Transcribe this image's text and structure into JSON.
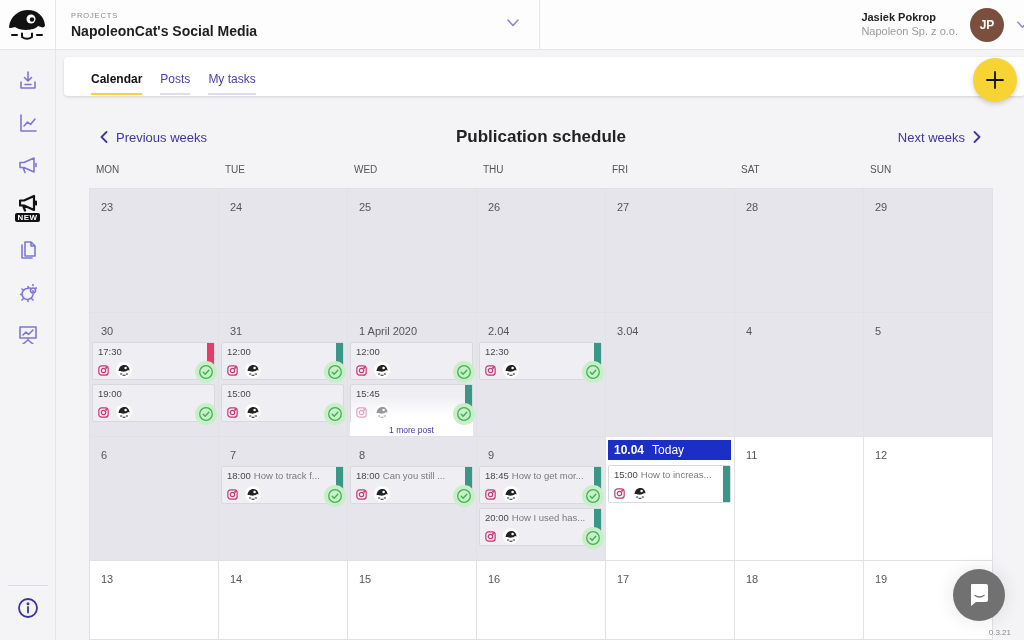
{
  "top_bar": {
    "project_label": "PROJECTS",
    "project_name": "NapoleonCat's Social Media",
    "user_name": "Jasiek Pokrop",
    "user_company": "Napoleon Sp. z o.o.",
    "user_initials": "JP"
  },
  "sidebar": {
    "items": [
      {
        "selected": false
      },
      {
        "selected": false
      },
      {
        "selected": false
      },
      {
        "selected": true,
        "badge": "NEW"
      },
      {
        "selected": false
      },
      {
        "selected": false
      },
      {
        "selected": false
      }
    ]
  },
  "tabs": [
    {
      "label": "Calendar",
      "selected": true
    },
    {
      "label": "Posts",
      "selected": false
    },
    {
      "label": "My tasks",
      "selected": false
    }
  ],
  "calendar": {
    "previous": "Previous weeks",
    "title": "Publication schedule",
    "next": "Next weeks",
    "weekdays": [
      "MON",
      "TUE",
      "WED",
      "THU",
      "FRI",
      "SAT",
      "SUN"
    ],
    "weeks": [
      {
        "days": [
          {
            "date": "23",
            "past": true,
            "today": false
          },
          {
            "date": "24",
            "past": true,
            "today": false
          },
          {
            "date": "25",
            "past": true,
            "today": false
          },
          {
            "date": "26",
            "past": true,
            "today": false
          },
          {
            "date": "27",
            "past": true,
            "today": false
          },
          {
            "date": "28",
            "past": true,
            "today": false
          },
          {
            "date": "29",
            "past": true,
            "today": false
          }
        ]
      },
      {
        "days": [
          {
            "date": "30",
            "past": true,
            "today": false,
            "posts": [
              {
                "time": "17:30",
                "color": "#e23d6b",
                "approved": true
              },
              {
                "time": "19:00",
                "approved": true
              }
            ]
          },
          {
            "date": "31",
            "past": true,
            "today": false,
            "posts": [
              {
                "time": "12:00",
                "color": "#3a9686",
                "approved": true
              },
              {
                "time": "15:00",
                "approved": true
              }
            ]
          },
          {
            "date": "1 April 2020",
            "past": true,
            "today": false,
            "posts": [
              {
                "time": "12:00",
                "approved": true
              },
              {
                "time": "15:45",
                "color": "#3a9686",
                "approved": true
              }
            ],
            "more": "1 more post"
          },
          {
            "date": "2.04",
            "past": true,
            "today": false,
            "posts": [
              {
                "time": "12:30",
                "color": "#3a9686",
                "approved": true
              }
            ]
          },
          {
            "date": "3.04",
            "past": true,
            "today": false
          },
          {
            "date": "4",
            "past": true,
            "today": false
          },
          {
            "date": "5",
            "past": true,
            "today": false
          }
        ]
      },
      {
        "days": [
          {
            "date": "6",
            "past": true,
            "today": false
          },
          {
            "date": "7",
            "past": true,
            "today": false,
            "posts": [
              {
                "time": "18:00",
                "title": "How to track f...",
                "color": "#3a9686",
                "approved": true
              }
            ]
          },
          {
            "date": "8",
            "past": true,
            "today": false,
            "posts": [
              {
                "time": "18:00",
                "title": "Can you still ...",
                "color": "#3a9686",
                "approved": true
              }
            ]
          },
          {
            "date": "9",
            "past": true,
            "today": false,
            "posts": [
              {
                "time": "18:45",
                "title": "How to get mor...",
                "color": "#3a9686",
                "approved": true
              },
              {
                "time": "20:00",
                "title": "How I used has...",
                "color": "#3a9686",
                "approved": true
              }
            ]
          },
          {
            "date": "10.04",
            "today_label": "Today",
            "past": false,
            "today": true,
            "posts": [
              {
                "time": "15:00",
                "title": "How to increas...",
                "color": "#3a9686",
                "approved": false
              }
            ]
          },
          {
            "date": "11",
            "past": false,
            "today": false
          },
          {
            "date": "12",
            "past": false,
            "today": false
          }
        ]
      },
      {
        "days": [
          {
            "date": "13",
            "past": false,
            "today": false
          },
          {
            "date": "14",
            "past": false,
            "today": false
          },
          {
            "date": "15",
            "past": false,
            "today": false
          },
          {
            "date": "16",
            "past": false,
            "today": false
          },
          {
            "date": "17",
            "past": false,
            "today": false
          },
          {
            "date": "18",
            "past": false,
            "today": false
          },
          {
            "date": "19",
            "past": false,
            "today": false
          }
        ]
      }
    ]
  },
  "version": "0.3.21"
}
